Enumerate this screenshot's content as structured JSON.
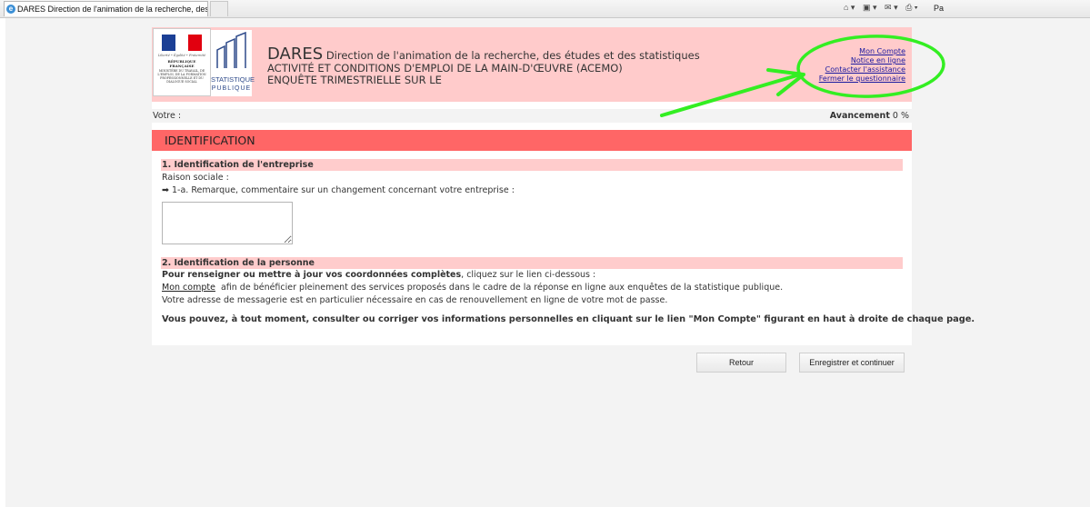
{
  "browser": {
    "tab_title": "DARES Direction de l'animation de la recherche, des é...",
    "tab_icon": "ie-icon",
    "tools": [
      "⌂ ▾",
      "▣ ▾",
      "✉ ▾",
      "⎙ ▾"
    ],
    "page_menu": "Pa"
  },
  "header": {
    "gov_motto": "Liberté • Égalité • Fraternité",
    "gov_republic": "RÉPUBLIQUE FRANÇAISE",
    "gov_ministry": "MINISTÈRE DU TRAVAIL, DE L'EMPLOI, DE LA FORMATION PROFESSIONNELLE ET DU DIALOGUE SOCIAL",
    "stat_line1": "STATISTIQUE",
    "stat_line2": "PUBLIQUE",
    "dares": "DARES",
    "direction": "Direction de l'animation de la recherche, des études et des statistiques",
    "line2": "ACTIVITÉ ET CONDITIONS D'EMPLOI DE LA MAIN-D'ŒUVRE (ACEMO)",
    "line3": "ENQUÊTE TRIMESTRIELLE SUR LE",
    "links": {
      "account": "Mon Compte",
      "notice": "Notice en ligne",
      "assistance": "Contacter l'assistance",
      "close": "Fermer le questionnaire"
    }
  },
  "status": {
    "votre": "Votre :",
    "avancement_label": "Avancement",
    "avancement_value": "0 %"
  },
  "section_title": "IDENTIFICATION",
  "section1": {
    "title": "1. Identification de l'entreprise",
    "raison_sociale": "Raison sociale :",
    "q1a": "➡ 1-a. Remarque, commentaire sur un changement concernant votre entreprise :",
    "comment_value": ""
  },
  "section2": {
    "title": "2. Identification de la personne",
    "intro_bold": "Pour renseigner ou mettre à jour vos coordonnées complètes",
    "intro_rest": ", cliquez sur le lien ci-dessous :",
    "mon_compte_link": "Mon compte",
    "mon_compte_rest": "afin de bénéficier pleinement des services proposés dans le cadre de la réponse en ligne aux enquêtes de la statistique publique.",
    "email_note": "Votre adresse de messagerie est en particulier nécessaire en cas de renouvellement en ligne de votre mot de passe.",
    "bold_note": "Vous pouvez, à tout moment, consulter ou corriger vos informations personnelles en cliquant sur le lien \"Mon Compte\" figurant en haut à droite de chaque page."
  },
  "buttons": {
    "retour": "Retour",
    "save_continue": "Enregistrer et continuer"
  },
  "colors": {
    "header_bg": "#ffcbcb",
    "section_bar": "#ff6666",
    "subsection_bar": "#ffcccc",
    "annotation_green": "#33ee22",
    "link": "#1a1aa0"
  }
}
